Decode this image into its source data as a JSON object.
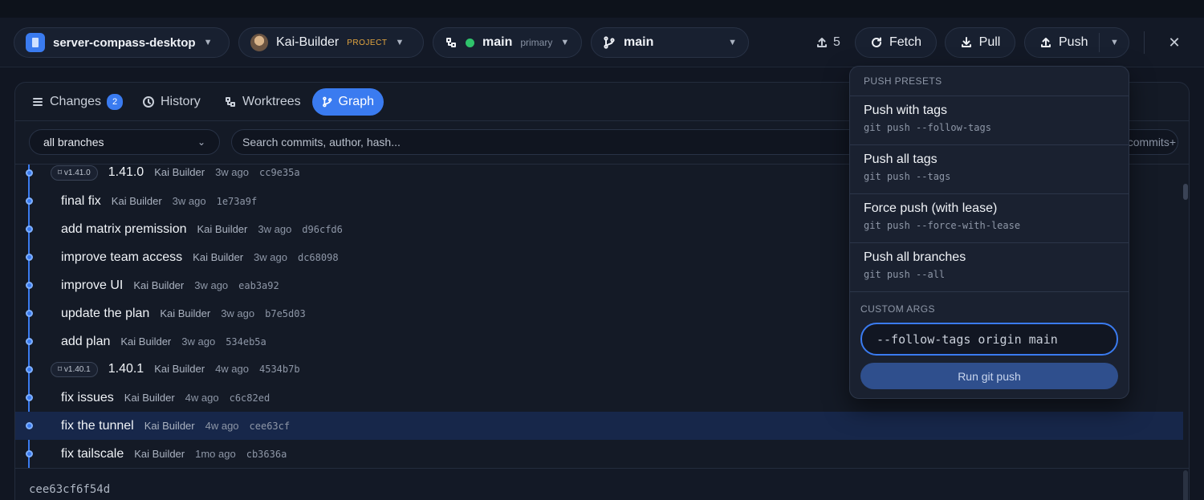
{
  "toolbar": {
    "repo": "server-compass-desktop",
    "user": "Kai-Builder",
    "user_badge": "PROJECT",
    "worktree_branch": "main",
    "worktree_tag": "primary",
    "branch": "main",
    "push_count": "5",
    "fetch_label": "Fetch",
    "pull_label": "Pull",
    "push_label": "Push",
    "close_glyph": "✕"
  },
  "tabs": [
    {
      "label": "Changes",
      "count": "2"
    },
    {
      "label": "History"
    },
    {
      "label": "Worktrees"
    },
    {
      "label": "Graph"
    }
  ],
  "filters": {
    "branch_select": "all branches",
    "search_placeholder": "Search commits, author, hash...",
    "commits_more": "commits+"
  },
  "commits": [
    {
      "tag": "⌑ v1.41.0",
      "message": "1.41.0",
      "author": "Kai Builder",
      "time": "3w ago",
      "hash": "cc9e35a"
    },
    {
      "message": "final fix",
      "author": "Kai Builder",
      "time": "3w ago",
      "hash": "1e73a9f"
    },
    {
      "message": "add matrix premission",
      "author": "Kai Builder",
      "time": "3w ago",
      "hash": "d96cfd6"
    },
    {
      "message": "improve team access",
      "author": "Kai Builder",
      "time": "3w ago",
      "hash": "dc68098"
    },
    {
      "message": "improve UI",
      "author": "Kai Builder",
      "time": "3w ago",
      "hash": "eab3a92"
    },
    {
      "message": "update the plan",
      "author": "Kai Builder",
      "time": "3w ago",
      "hash": "b7e5d03"
    },
    {
      "message": "add plan",
      "author": "Kai Builder",
      "time": "3w ago",
      "hash": "534eb5a"
    },
    {
      "tag": "⌑ v1.40.1",
      "message": "1.40.1",
      "author": "Kai Builder",
      "time": "4w ago",
      "hash": "4534b7b"
    },
    {
      "message": "fix issues",
      "author": "Kai Builder",
      "time": "4w ago",
      "hash": "c6c82ed"
    },
    {
      "message": "fix the tunnel",
      "author": "Kai Builder",
      "time": "4w ago",
      "hash": "cee63cf",
      "selected": true
    },
    {
      "message": "fix tailscale",
      "author": "Kai Builder",
      "time": "1mo ago",
      "hash": "cb3636a"
    }
  ],
  "detail": {
    "full_hash": "cee63cf6f54d"
  },
  "push_menu": {
    "header": "PUSH PRESETS",
    "presets": [
      {
        "title": "Push with tags",
        "cmd": "git push --follow-tags"
      },
      {
        "title": "Push all tags",
        "cmd": "git push --tags"
      },
      {
        "title": "Force push (with lease)",
        "cmd": "git push --force-with-lease"
      },
      {
        "title": "Push all branches",
        "cmd": "git push --all"
      }
    ],
    "custom_label": "CUSTOM ARGS",
    "custom_value": "--follow-tags origin main",
    "run_label": "Run git push"
  },
  "colors": {
    "accent": "#3a7bf0",
    "online": "#2fc36b",
    "badge": "#e5a740"
  }
}
